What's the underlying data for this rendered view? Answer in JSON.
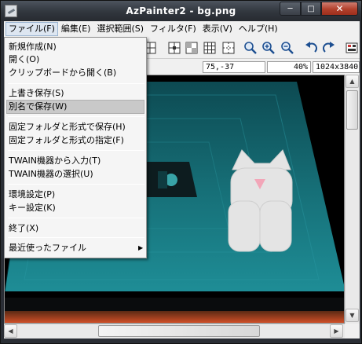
{
  "window": {
    "title": "AzPainter2 - bg.png",
    "minimize_glyph": "─",
    "maximize_glyph": "□",
    "close_glyph": "✕"
  },
  "menubar": {
    "items": [
      {
        "label": "ファイル(F)"
      },
      {
        "label": "編集(E)"
      },
      {
        "label": "選択範囲(S)"
      },
      {
        "label": "フィルタ(F)"
      },
      {
        "label": "表示(V)"
      },
      {
        "label": "ヘルプ(H)"
      }
    ]
  },
  "file_menu": {
    "items": [
      {
        "label": "新規作成(N)"
      },
      {
        "label": "開く(O)"
      },
      {
        "label": "クリップボードから開く(B)"
      },
      {
        "label": "上書き保存(S)"
      },
      {
        "label": "別名で保存(W)",
        "highlighted": true
      },
      {
        "label": "固定フォルダと形式で保存(H)"
      },
      {
        "label": "固定フォルダと形式の指定(F)"
      },
      {
        "label": "TWAIN機器から入力(T)"
      },
      {
        "label": "TWAIN機器の選択(U)"
      },
      {
        "label": "環境設定(P)"
      },
      {
        "label": "キー設定(K)"
      },
      {
        "label": "終了(X)"
      },
      {
        "label": "最近使ったファイル",
        "submenu_glyph": "▶"
      }
    ]
  },
  "toolbar": {
    "icons": [
      "grid-snap-icon",
      "transparency-icon",
      "grid-icon",
      "ruler-icon",
      "zoom-icon",
      "zoom-in-icon",
      "zoom-out-icon",
      "undo-icon",
      "redo-icon",
      "tool-icon"
    ]
  },
  "status": {
    "coordinates": "75,-37",
    "zoom": "40%",
    "image_size": "1024x3840"
  },
  "scrollbar": {
    "up": "▲",
    "down": "▼",
    "left": "◀",
    "right": "▶"
  },
  "colors": {
    "teal_floor": "#1e7f86",
    "highlight": "#c9c9c9"
  }
}
